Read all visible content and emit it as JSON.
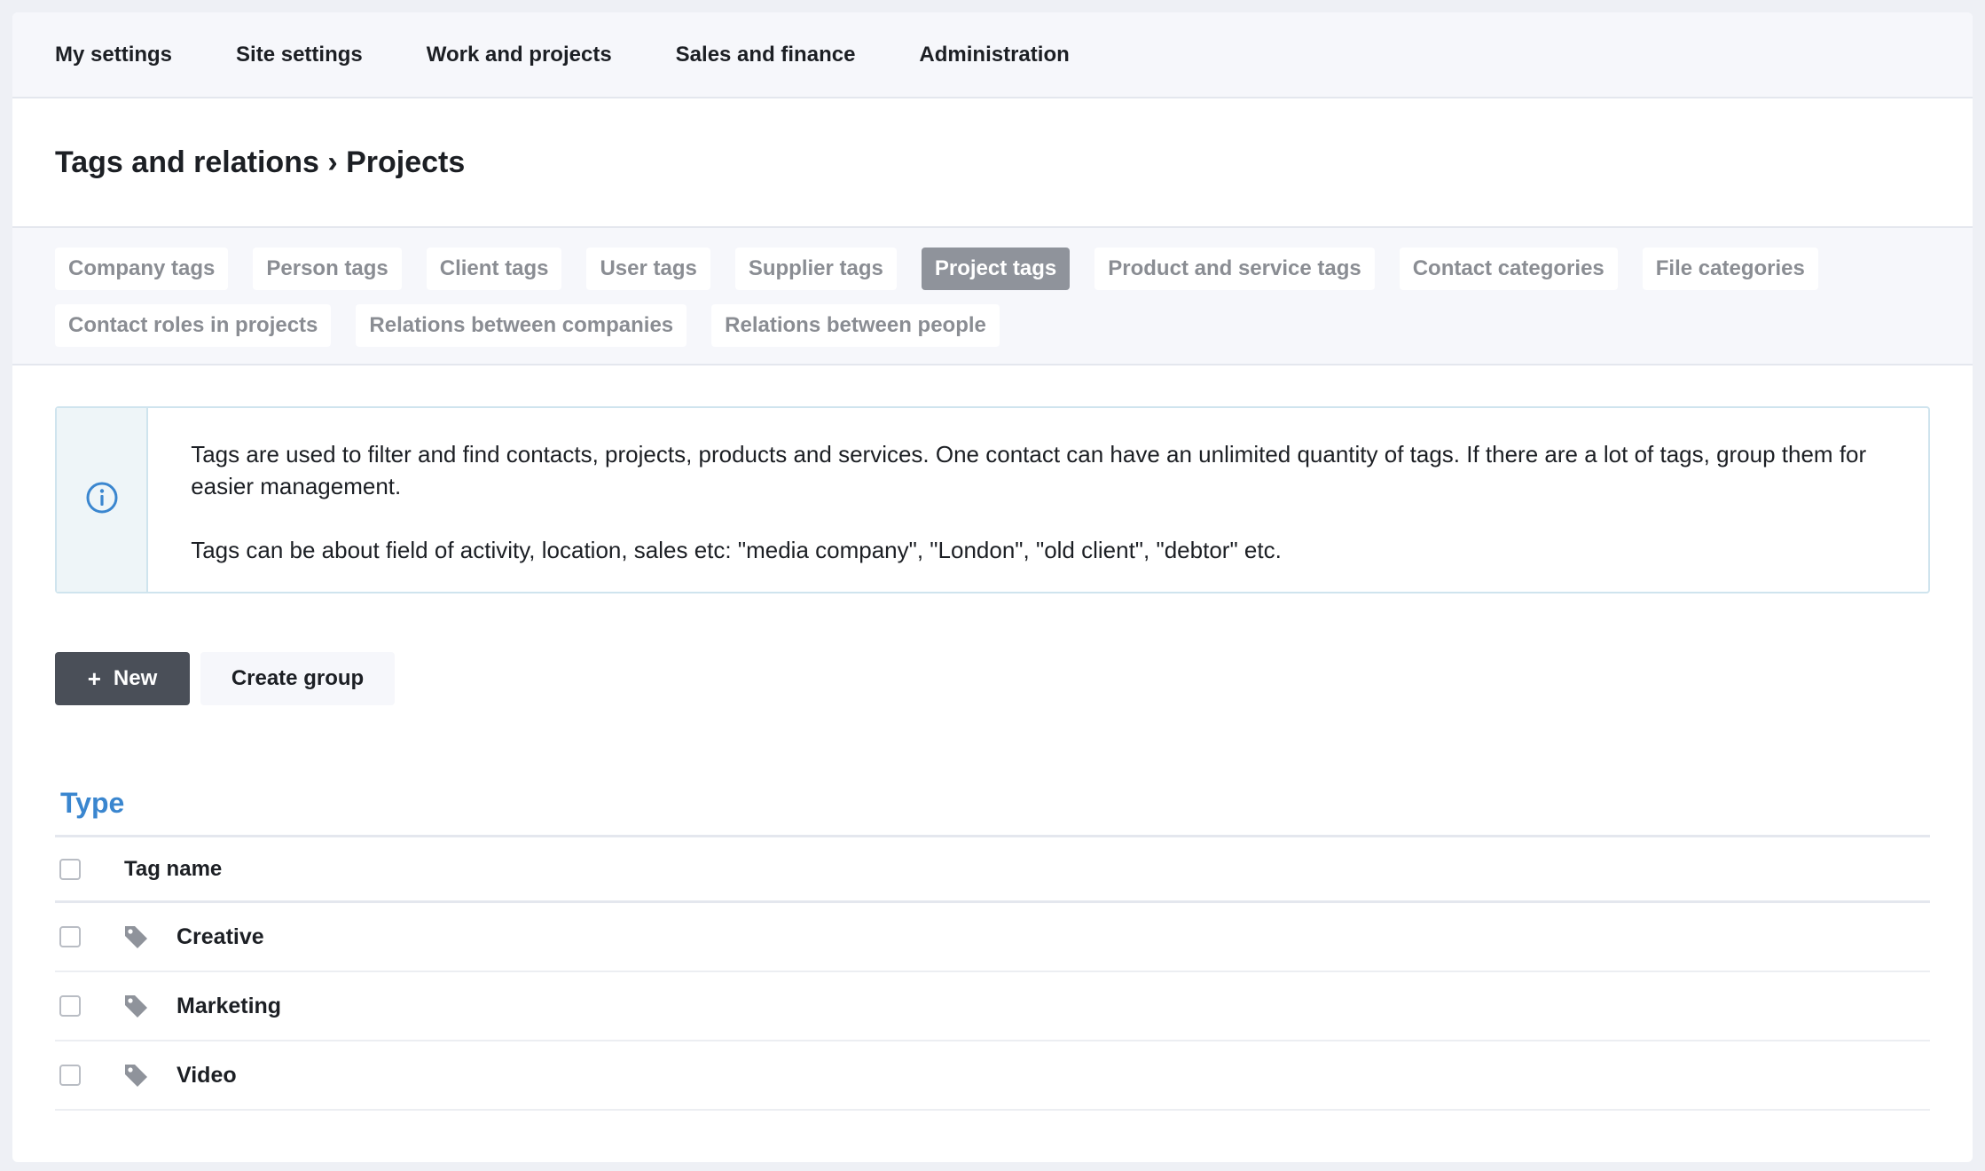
{
  "topnav": {
    "items": [
      "My settings",
      "Site settings",
      "Work and projects",
      "Sales and finance",
      "Administration"
    ]
  },
  "page": {
    "title": "Tags and relations › Projects"
  },
  "tabs": {
    "row1": [
      "Company tags",
      "Person tags",
      "Client tags",
      "User tags",
      "Supplier tags",
      "Project tags",
      "Product and service tags",
      "Contact categories",
      "File categories"
    ],
    "row2": [
      "Contact roles in projects",
      "Relations between companies",
      "Relations between people"
    ],
    "active": "Project tags"
  },
  "info": {
    "icon": "info-icon",
    "paragraph1": "Tags are used to filter and find contacts, projects, products and services. One contact can have an unlimited quantity of tags. If there are a lot of tags, group them for easier management.",
    "paragraph2": "Tags can be about field of activity, location, sales etc: \"media company\", \"London\", \"old client\", \"debtor\" etc."
  },
  "actions": {
    "new_label": "New",
    "new_icon": "plus-icon",
    "create_group_label": "Create group"
  },
  "group": {
    "title": "Type",
    "table": {
      "header": "Tag name",
      "rows": [
        "Creative",
        "Marketing",
        "Video"
      ],
      "row_icon": "tag-icon"
    }
  },
  "colors": {
    "accent": "#3a86cf",
    "active_tab": "#8f939b",
    "primary_button": "#4a4f58"
  }
}
